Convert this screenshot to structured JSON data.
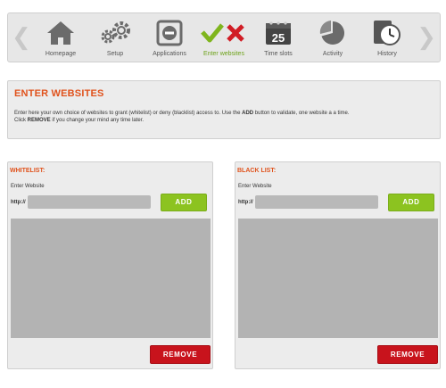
{
  "nav": {
    "items": [
      {
        "label": "Homepage",
        "icon": "home-icon"
      },
      {
        "label": "Setup",
        "icon": "gears-icon"
      },
      {
        "label": "Applications",
        "icon": "minus-box-icon"
      },
      {
        "label": "Enter websites",
        "icon": "check-cross-icon",
        "active": true
      },
      {
        "label": "Time slots",
        "icon": "calendar-icon",
        "calendar_number": "25"
      },
      {
        "label": "Activity",
        "icon": "pie-chart-icon"
      },
      {
        "label": "History",
        "icon": "clock-book-icon"
      }
    ],
    "active_color": "#6da21a"
  },
  "intro": {
    "title": "ENTER WEBSITES",
    "line1_prefix": "Enter here your own choice of websites to grant (whitelist) or deny (blacklist) access to. Use the ",
    "line1_bold": "ADD",
    "line1_suffix": " button to validate, one website a a time.",
    "line2_prefix": "Click ",
    "line2_bold": "REMOVE",
    "line2_suffix": " if you change your mind any time later."
  },
  "whitelist": {
    "title": "WHITELIST:",
    "enter_label": "Enter Website",
    "http_label": "http://",
    "input_value": "",
    "add_label": "ADD",
    "remove_label": "REMOVE"
  },
  "blacklist": {
    "title": "BLACK LIST:",
    "enter_label": "Enter Website",
    "http_label": "http://",
    "input_value": "",
    "add_label": "ADD",
    "remove_label": "REMOVE"
  },
  "colors": {
    "accent_orange": "#e0521c",
    "add_green": "#8cc320",
    "remove_red": "#c8131c"
  }
}
